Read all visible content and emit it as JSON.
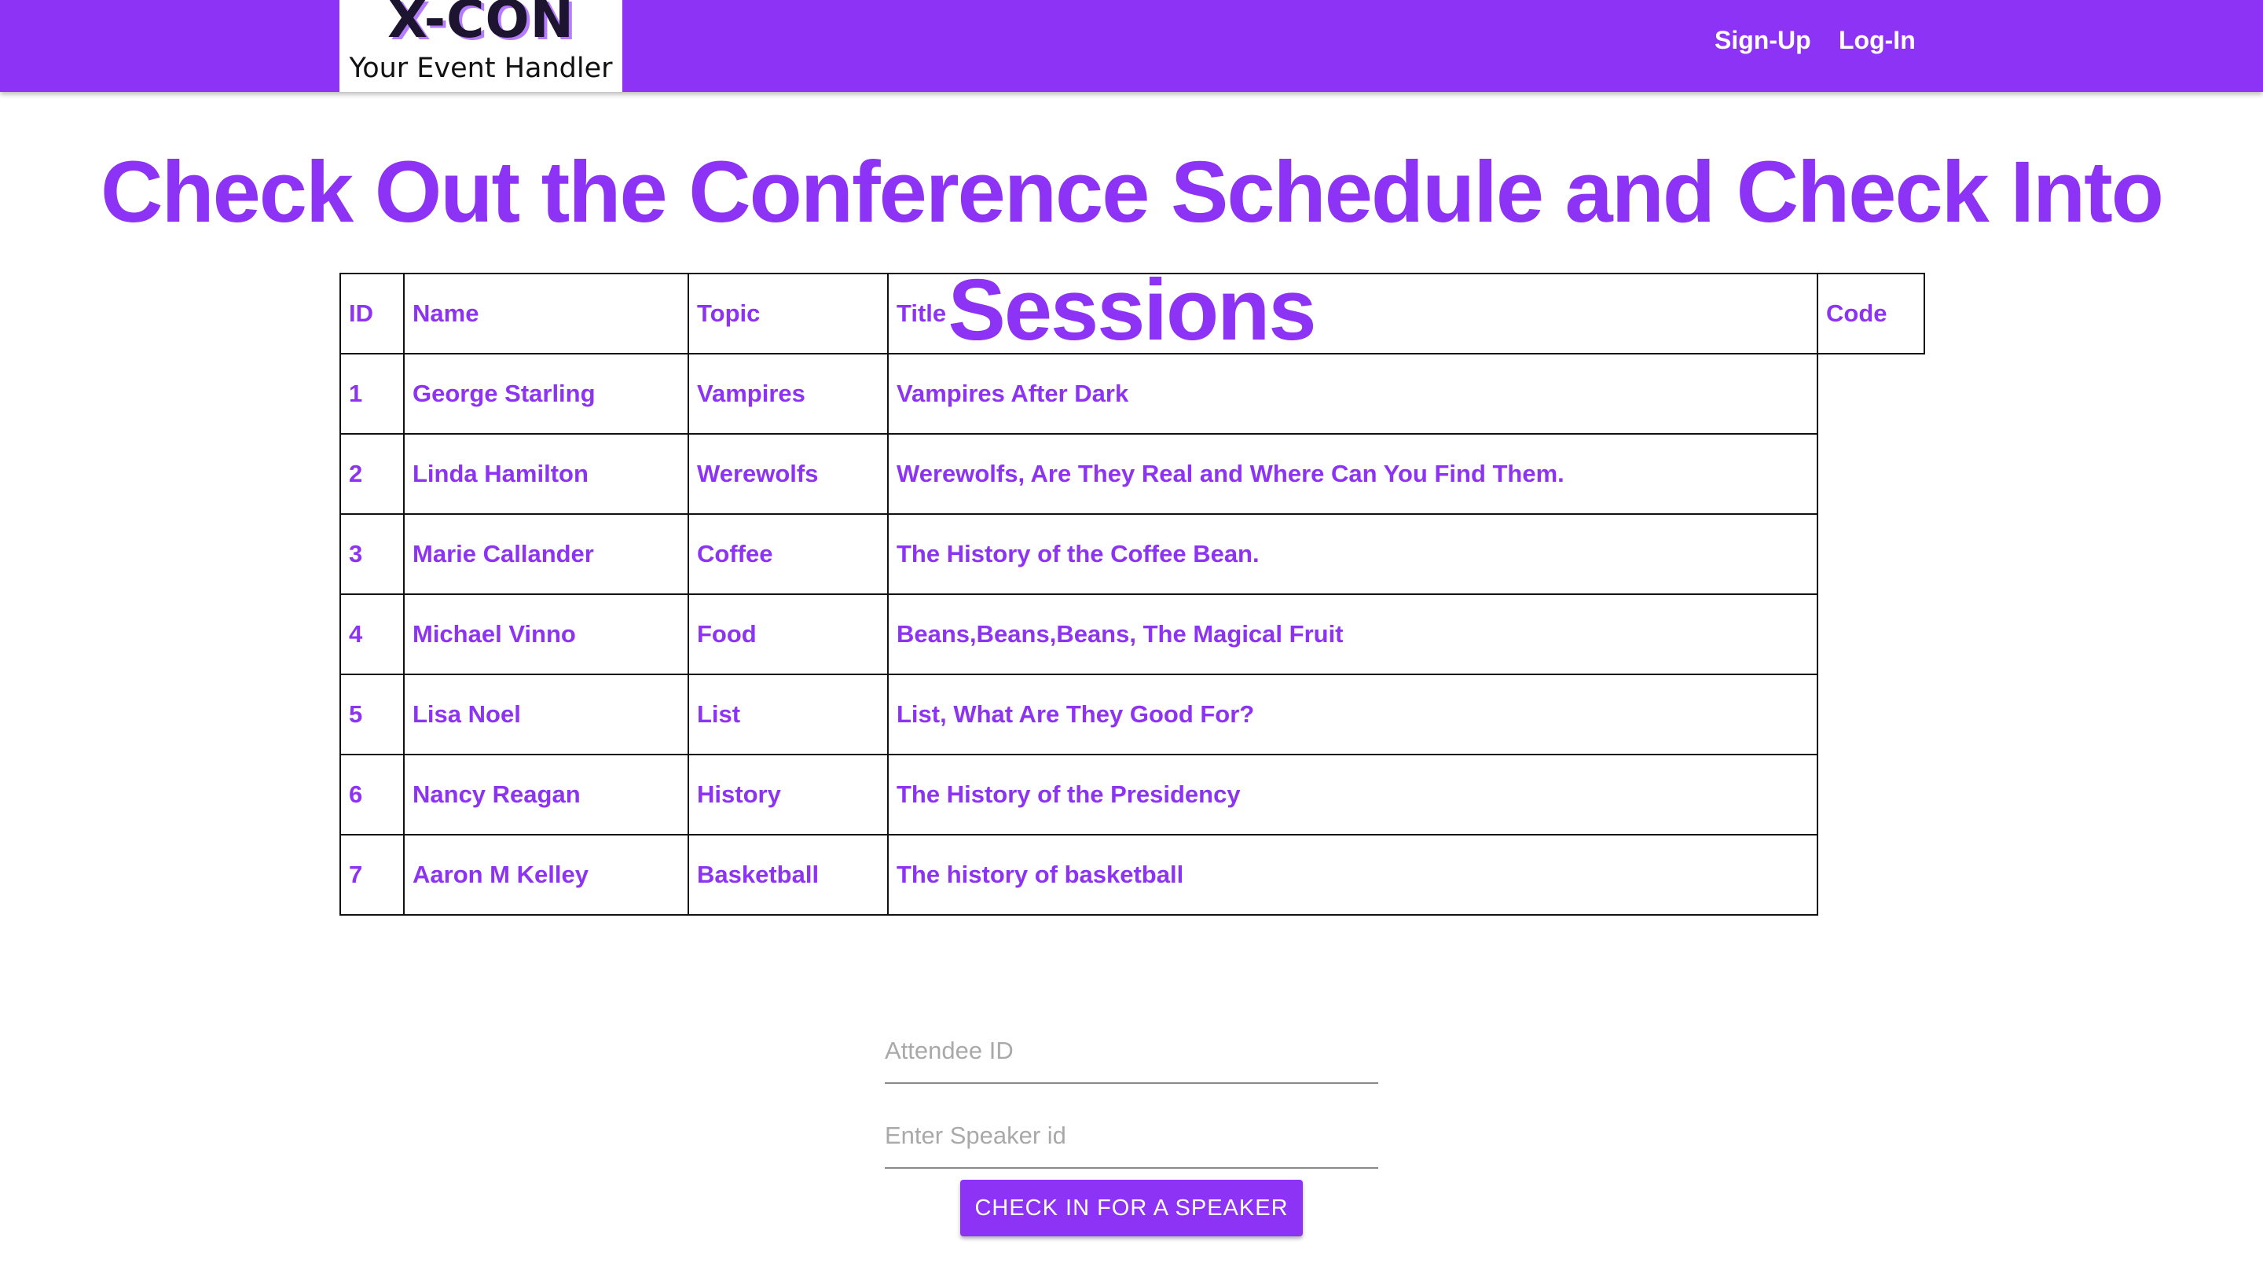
{
  "header": {
    "logo": {
      "mark": "X-CON",
      "tagline": "Your Event Handler"
    },
    "nav": {
      "signup_label": "Sign-Up",
      "login_label": "Log-In"
    }
  },
  "main": {
    "title": "Check Out the Conference Schedule and Check Into Sessions",
    "table": {
      "headers": {
        "id": "ID",
        "name": "Name",
        "topic": "Topic",
        "title": "Title",
        "code": "Code"
      },
      "rows": [
        {
          "id": "1",
          "name": "George Starling",
          "topic": "Vampires",
          "title": "Vampires After Dark",
          "code": ""
        },
        {
          "id": "2",
          "name": "Linda Hamilton",
          "topic": "Werewolfs",
          "title": "Werewolfs, Are They Real and Where Can You Find Them.",
          "code": ""
        },
        {
          "id": "3",
          "name": "Marie Callander",
          "topic": "Coffee",
          "title": "The History of the Coffee Bean.",
          "code": ""
        },
        {
          "id": "4",
          "name": "Michael Vinno",
          "topic": "Food",
          "title": "Beans,Beans,Beans, The Magical Fruit",
          "code": ""
        },
        {
          "id": "5",
          "name": "Lisa Noel",
          "topic": "List",
          "title": "List, What Are They Good For?",
          "code": ""
        },
        {
          "id": "6",
          "name": "Nancy Reagan",
          "topic": "History",
          "title": "The History of the Presidency",
          "code": ""
        },
        {
          "id": "7",
          "name": "Aaron M Kelley",
          "topic": "Basketball",
          "title": "The history of basketball",
          "code": ""
        }
      ]
    },
    "form": {
      "attendee_placeholder": "Attendee ID",
      "attendee_value": "",
      "speaker_placeholder": "Enter Speaker id",
      "speaker_value": "",
      "submit_label": "CHECK IN FOR A SPEAKER"
    }
  },
  "colors": {
    "brand": "#8c33f6",
    "text_on_brand": "#ffffff",
    "border": "#111111"
  }
}
